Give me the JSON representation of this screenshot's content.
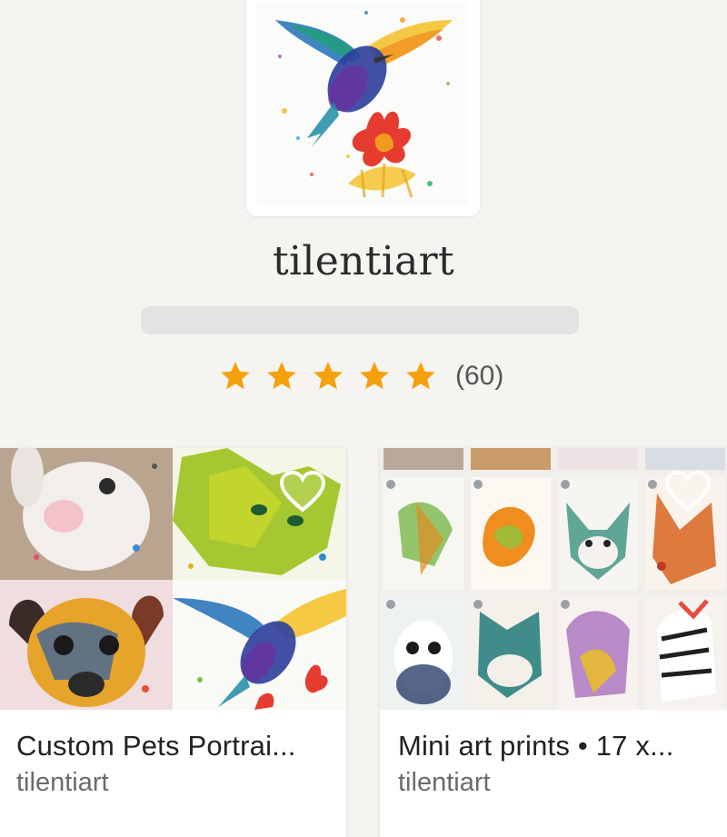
{
  "shop": {
    "name": "tilentiart",
    "rating_count": "(60)",
    "stars": 5
  },
  "collections": [
    {
      "title": "Custom Pets Portrai...",
      "owner": "tilentiart"
    },
    {
      "title": "Mini art prints • 17 x...",
      "owner": "tilentiart"
    }
  ],
  "icons": {
    "star": "star-icon",
    "heart": "heart-icon"
  },
  "colors": {
    "star": "#f5a00c",
    "background": "#f5f4f1"
  }
}
